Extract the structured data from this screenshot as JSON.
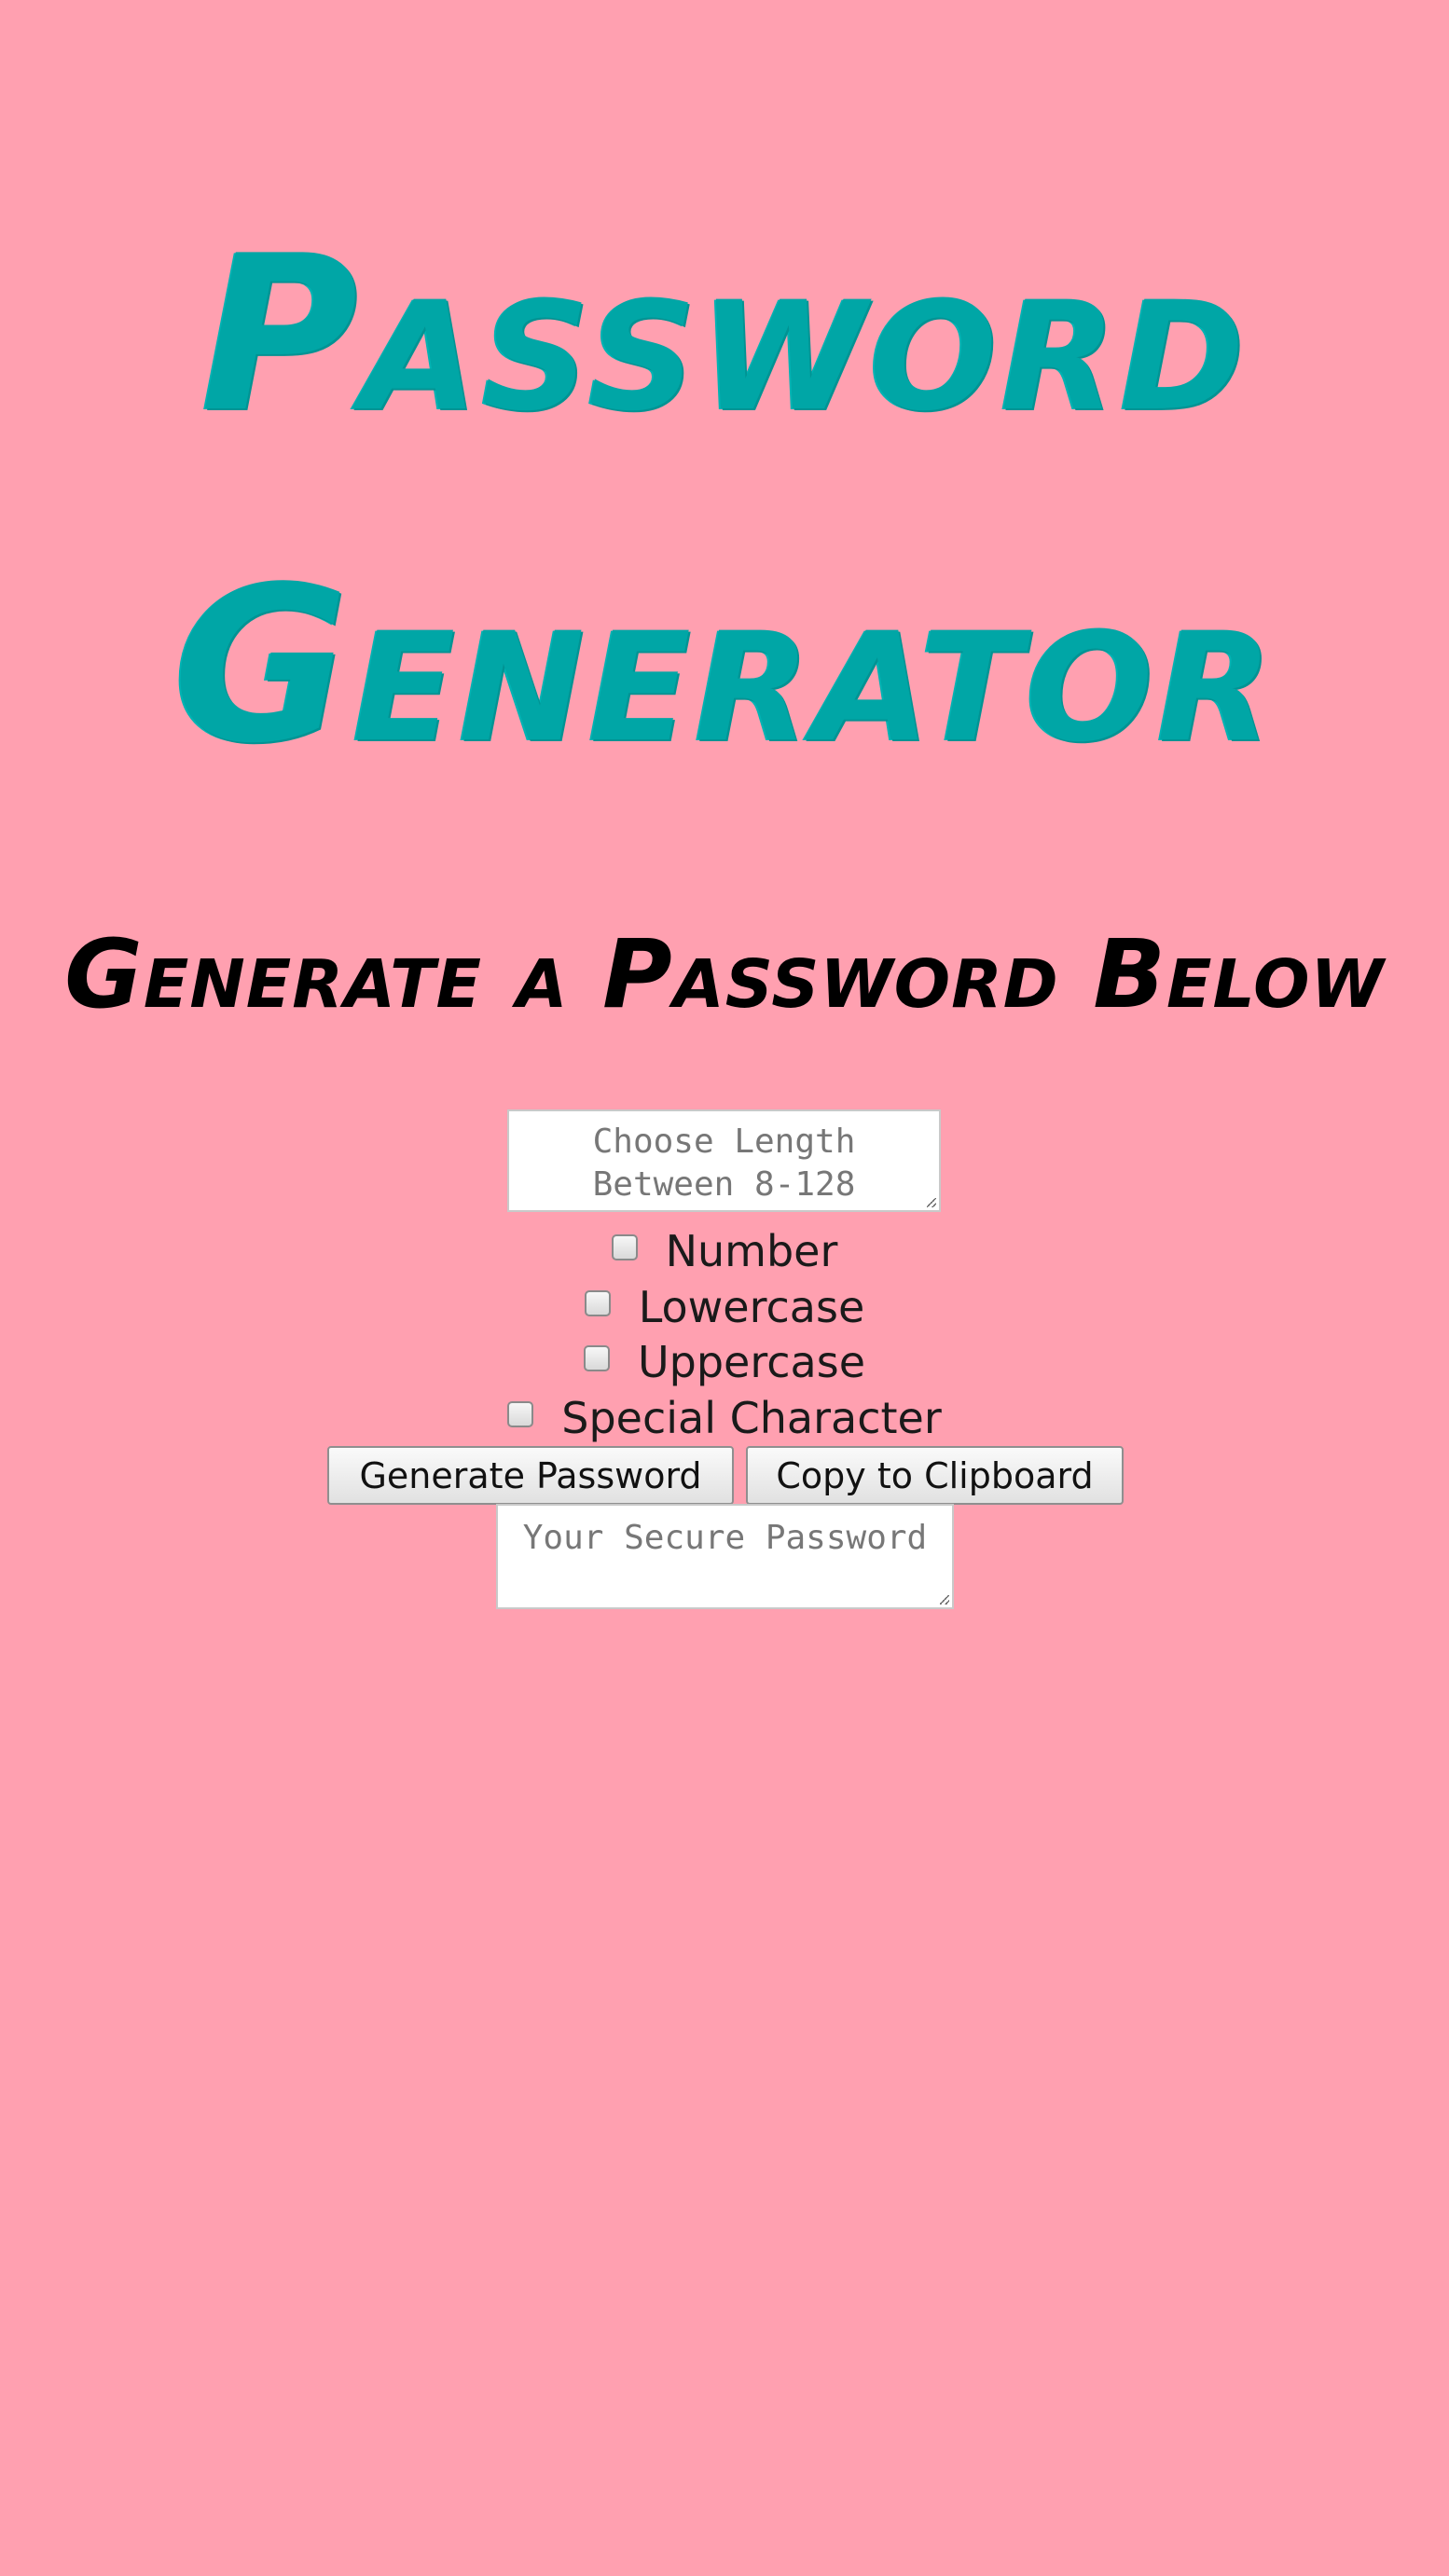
{
  "header": {
    "title_line1": "Password",
    "title_line2": "Generator",
    "subtitle": "Generate a Password Below"
  },
  "form": {
    "length_placeholder": "Choose Length Between 8-128",
    "options": [
      {
        "label": "Number"
      },
      {
        "label": "Lowercase"
      },
      {
        "label": "Uppercase"
      },
      {
        "label": "Special Character"
      }
    ],
    "generate_label": "Generate Password",
    "copy_label": "Copy to Clipboard",
    "password_placeholder": "Your Secure Password"
  },
  "colors": {
    "background": "#ffa0b0",
    "title": "#00a6a6",
    "subtitle": "#000000"
  }
}
